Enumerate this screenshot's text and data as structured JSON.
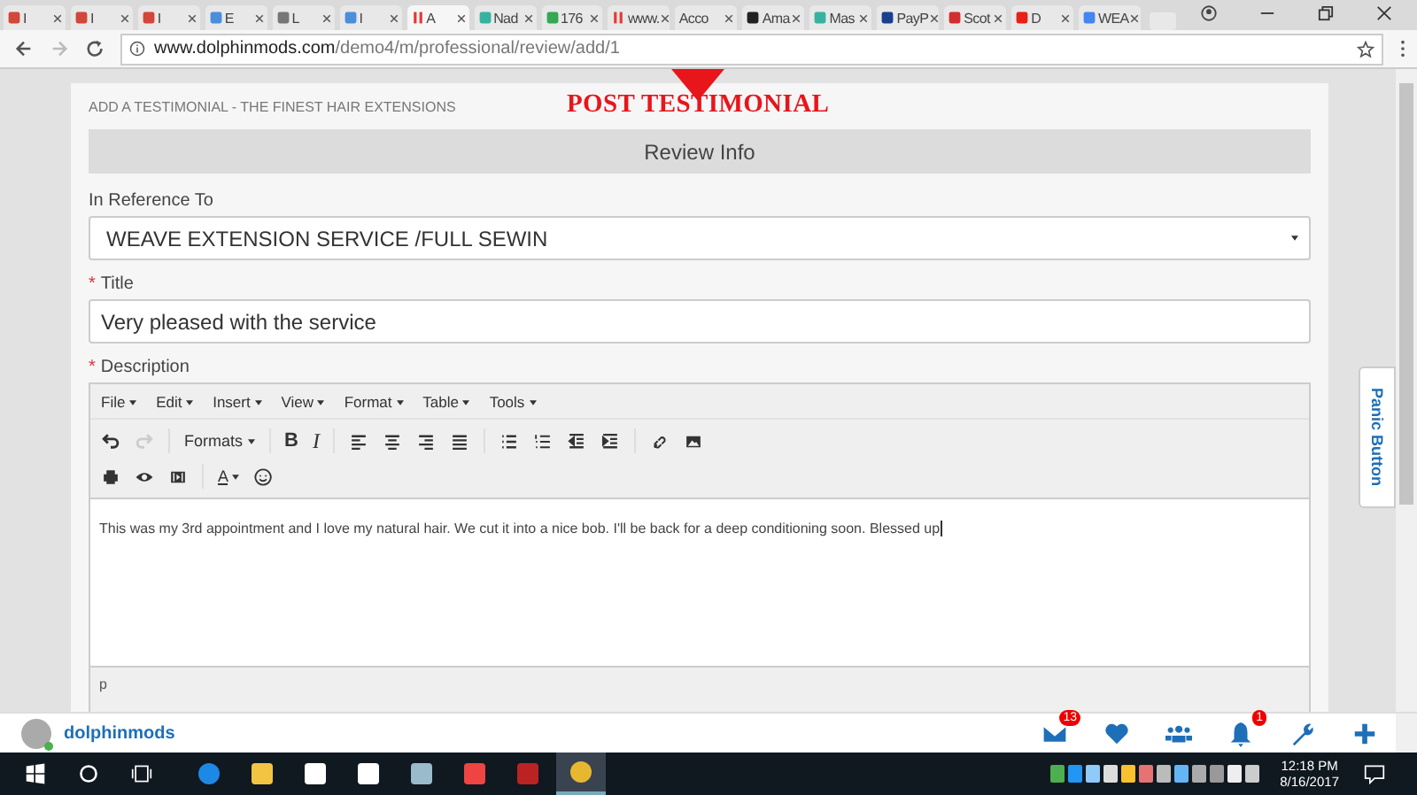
{
  "browser": {
    "tabs": [
      {
        "label": "I",
        "kind": "gmail",
        "selected": false
      },
      {
        "label": "I",
        "kind": "gmail",
        "selected": false
      },
      {
        "label": "I",
        "kind": "gmail",
        "selected": false
      },
      {
        "label": "E",
        "kind": "loop",
        "selected": false
      },
      {
        "label": "L",
        "kind": "page",
        "selected": false
      },
      {
        "label": "I",
        "kind": "loop",
        "selected": false
      },
      {
        "label": "A",
        "kind": "bars",
        "selected": true
      },
      {
        "label": "Nad",
        "kind": "tile",
        "selected": false
      },
      {
        "label": "176",
        "kind": "map",
        "selected": false
      },
      {
        "label": "www.",
        "kind": "bars",
        "selected": false
      },
      {
        "label": "Acco",
        "kind": "none",
        "selected": false
      },
      {
        "label": "Ama",
        "kind": "amazon",
        "selected": false
      },
      {
        "label": "Mas",
        "kind": "tile",
        "selected": false
      },
      {
        "label": "PayP",
        "kind": "paypal",
        "selected": false
      },
      {
        "label": "Scot",
        "kind": "scot",
        "selected": false
      },
      {
        "label": "D",
        "kind": "video",
        "selected": false
      },
      {
        "label": "WEA",
        "kind": "google",
        "selected": false
      }
    ],
    "url_host": "www.dolphinmods.com",
    "url_path": "/demo4/m/professional/review/add/1"
  },
  "annotation": {
    "text": "POST TESTIMONIAL"
  },
  "page": {
    "heading": "ADD A TESTIMONIAL - THE FINEST HAIR EXTENSIONS",
    "section_title": "Review Info",
    "fields": [
      {
        "label": "In Reference To",
        "kind": "select",
        "value": "WEAVE EXTENSION SERVICE /FULL SEWIN"
      },
      {
        "required_mark": "*",
        "label": "Title",
        "kind": "text",
        "value": "Very pleased with the service"
      }
    ],
    "description": {
      "required_mark": "*",
      "label": "Description",
      "menu": [
        "File",
        "Edit",
        "Insert",
        "View",
        "Format",
        "Table",
        "Tools"
      ],
      "toolbar_row_1": [
        {
          "kind": "undo",
          "disabled": false
        },
        {
          "kind": "redo",
          "disabled": true
        },
        {
          "kind": "sep"
        },
        {
          "kind": "dropdown",
          "text": "Formats"
        },
        {
          "kind": "sep"
        },
        {
          "kind": "bold",
          "text": "B"
        },
        {
          "kind": "italic",
          "text": "I"
        },
        {
          "kind": "sep"
        },
        {
          "kind": "align-left"
        },
        {
          "kind": "align-center"
        },
        {
          "kind": "align-right"
        },
        {
          "kind": "justify"
        },
        {
          "kind": "sep"
        },
        {
          "kind": "bullets"
        },
        {
          "kind": "numbers"
        },
        {
          "kind": "outdent"
        },
        {
          "kind": "indent"
        },
        {
          "kind": "sep"
        },
        {
          "kind": "link"
        },
        {
          "kind": "image"
        }
      ],
      "toolbar_row_2": [
        {
          "kind": "print"
        },
        {
          "kind": "preview"
        },
        {
          "kind": "media"
        },
        {
          "kind": "sep"
        },
        {
          "kind": "color",
          "text": "A"
        },
        {
          "kind": "emoticon"
        }
      ],
      "content": "This was my 3rd appointment and I love my natural hair. We cut it into a nice bob. I'll be back for a deep conditioning soon. Blessed up",
      "path": "p"
    },
    "side_tab": "Panic Button"
  },
  "app_bar": {
    "username": "dolphinmods",
    "online": true,
    "actions": [
      {
        "kind": "mail",
        "badge": "13"
      },
      {
        "kind": "heart"
      },
      {
        "kind": "people"
      },
      {
        "kind": "bell",
        "badge": "1"
      },
      {
        "kind": "wrench"
      },
      {
        "kind": "plus"
      }
    ]
  },
  "taskbar": {
    "apps": [
      {
        "kind": "edge",
        "selected": false
      },
      {
        "kind": "folder",
        "selected": false
      },
      {
        "kind": "store",
        "selected": false
      },
      {
        "kind": "mail",
        "selected": false
      },
      {
        "kind": "paint",
        "selected": false
      },
      {
        "kind": "app",
        "selected": false
      },
      {
        "kind": "filezilla",
        "selected": false
      },
      {
        "kind": "chrome",
        "selected": true
      }
    ],
    "time": "12:18 PM",
    "date": "8/16/2017"
  }
}
